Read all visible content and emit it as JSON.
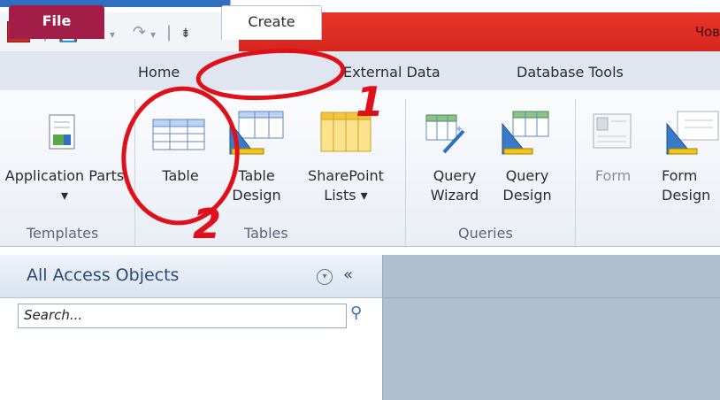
{
  "title_partial": "Чов",
  "tabs": [
    {
      "label": "File"
    },
    {
      "label": "Home"
    },
    {
      "label": "Create"
    },
    {
      "label": "External Data"
    },
    {
      "label": "Database Tools"
    }
  ],
  "ribbon": {
    "templates": {
      "label": "Templates",
      "application_parts": "Application Parts ▾"
    },
    "tables": {
      "label": "Tables",
      "table": "Table",
      "table_design": "Table Design",
      "sharepoint_lists": "SharePoint Lists ▾"
    },
    "queries": {
      "label": "Queries",
      "query_wizard": "Query Wizard",
      "query_design": "Query Design"
    },
    "forms": {
      "form": "Form",
      "form_design": "Form Design"
    }
  },
  "nav_pane": {
    "title": "All Access Objects",
    "collapse": "«",
    "search_placeholder": "Search..."
  },
  "annotations": {
    "one": "1",
    "two": "2"
  },
  "colors": {
    "title_red": "#d6261e",
    "file_tab": "#a21d47",
    "annotation": "#e0101a"
  }
}
